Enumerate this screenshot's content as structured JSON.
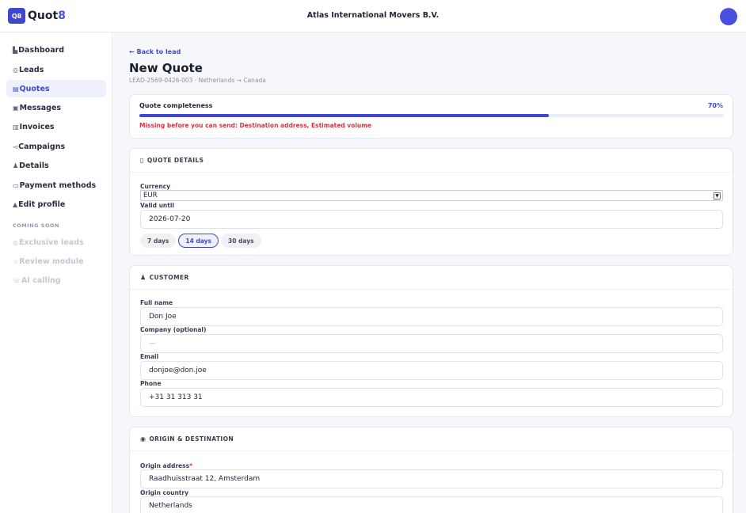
{
  "header": {
    "logo_badge": "Q8",
    "logo_text": "Quot",
    "logo_accent": "8",
    "company": "Atlas International Movers B.V."
  },
  "sidebar": {
    "items": [
      {
        "icon": "▙",
        "label": "Dashboard",
        "icon_name": "chart-icon"
      },
      {
        "icon": "◎",
        "label": "Leads",
        "icon_name": "target-icon"
      },
      {
        "icon": "▤",
        "label": "Quotes",
        "icon_name": "document-icon"
      },
      {
        "icon": "▣",
        "label": "Messages",
        "icon_name": "message-icon"
      },
      {
        "icon": "▥",
        "label": "Invoices",
        "icon_name": "invoice-icon"
      },
      {
        "icon": "◅",
        "label": "Campaigns",
        "icon_name": "megaphone-icon"
      },
      {
        "icon": "♟",
        "label": "Details",
        "icon_name": "person-icon"
      },
      {
        "icon": "▭",
        "label": "Payment methods",
        "icon_name": "card-icon"
      },
      {
        "icon": "▲",
        "label": "Edit profile",
        "icon_name": "profile-icon"
      }
    ],
    "soon_label": "COMING SOON",
    "soon_items": [
      {
        "icon": "◎",
        "label": "Exclusive leads",
        "icon_name": "target-icon"
      },
      {
        "icon": "☆",
        "label": "Review module",
        "icon_name": "star-icon"
      },
      {
        "icon": "☏",
        "label": "AI calling",
        "icon_name": "robot-icon"
      }
    ],
    "active_index": 2
  },
  "page": {
    "back": "← Back to lead",
    "title": "New Quote",
    "subtitle": "LEAD-2569-0426-003 · Netherlands → Canada"
  },
  "completeness": {
    "label": "Quote completeness",
    "percent_text": "70%",
    "percent": 70,
    "missing": "Missing before you can send: Destination address, Estimated volume"
  },
  "quote_details": {
    "icon": "▯",
    "title": "QUOTE DETAILS",
    "currency_label": "Currency",
    "currency_value": "EUR",
    "valid_until_label": "Valid until",
    "valid_until_value": "2026-07-20",
    "chips": [
      "7 days",
      "14 days",
      "30 days"
    ],
    "active_chip": 1
  },
  "customer": {
    "icon": "♟",
    "title": "CUSTOMER",
    "full_name_label": "Full name",
    "full_name_value": "Don Joe",
    "company_label": "Company (optional)",
    "company_placeholder": "—",
    "email_label": "Email",
    "email_value": "donjoe@don.joe",
    "phone_label": "Phone",
    "phone_value": "+31 31 313 31"
  },
  "origin_destination": {
    "icon": "◉",
    "title": "ORIGIN & DESTINATION",
    "origin_address_label": "Origin address",
    "required_mark": "*",
    "origin_address_value": "Raadhuisstraat 12, Amsterdam",
    "origin_country_label": "Origin country",
    "origin_country_value": "Netherlands"
  },
  "colors": {
    "accent": "#3f48cc",
    "error": "#e0323e",
    "avatar": "#4b4fe0"
  }
}
